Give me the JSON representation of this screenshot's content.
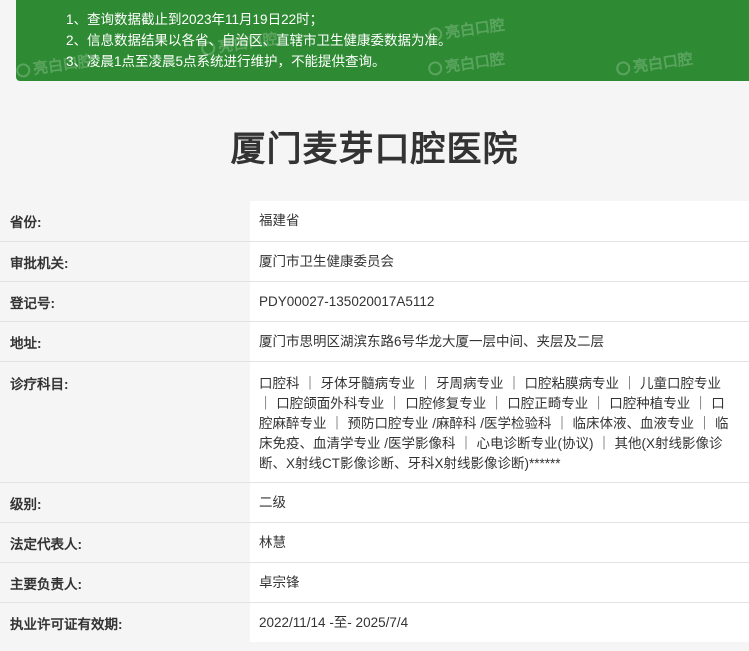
{
  "notice": {
    "lines": [
      "1、查询数据截止到2023年11月19日22时；",
      "2、信息数据结果以各省、自治区、直辖市卫生健康委数据为准。",
      "3、凌晨1点至凌晨5点系统进行维护，不能提供查询。"
    ],
    "watermark": "亮白口腔"
  },
  "title": "厦门麦芽口腔医院",
  "rows": [
    {
      "label": "省份:",
      "value": "福建省"
    },
    {
      "label": "审批机关:",
      "value": "厦门市卫生健康委员会"
    },
    {
      "label": "登记号:",
      "value": "PDY00027-135020017A5112"
    },
    {
      "label": "地址:",
      "value": "厦门市思明区湖滨东路6号华龙大厦一层中间、夹层及二层"
    },
    {
      "label": "诊疗科目:",
      "value": "口腔科 ｜ 牙体牙髓病专业 ｜ 牙周病专业 ｜ 口腔粘膜病专业 ｜ 儿童口腔专业 ｜ 口腔颌面外科专业 ｜ 口腔修复专业 ｜ 口腔正畸专业 ｜ 口腔种植专业 ｜ 口腔麻醉专业 ｜ 预防口腔专业 /麻醉科 /医学检验科 ｜ 临床体液、血液专业 ｜ 临床免疫、血清学专业 /医学影像科 ｜ 心电诊断专业(协议) ｜ 其他(X射线影像诊断、X射线CT影像诊断、牙科X射线影像诊断)******"
    },
    {
      "label": "级别:",
      "value": "二级"
    },
    {
      "label": "法定代表人:",
      "value": "林慧"
    },
    {
      "label": "主要负责人:",
      "value": "卓宗锋"
    },
    {
      "label": "执业许可证有效期:",
      "value": "2022/11/14 -至- 2025/7/4"
    }
  ]
}
